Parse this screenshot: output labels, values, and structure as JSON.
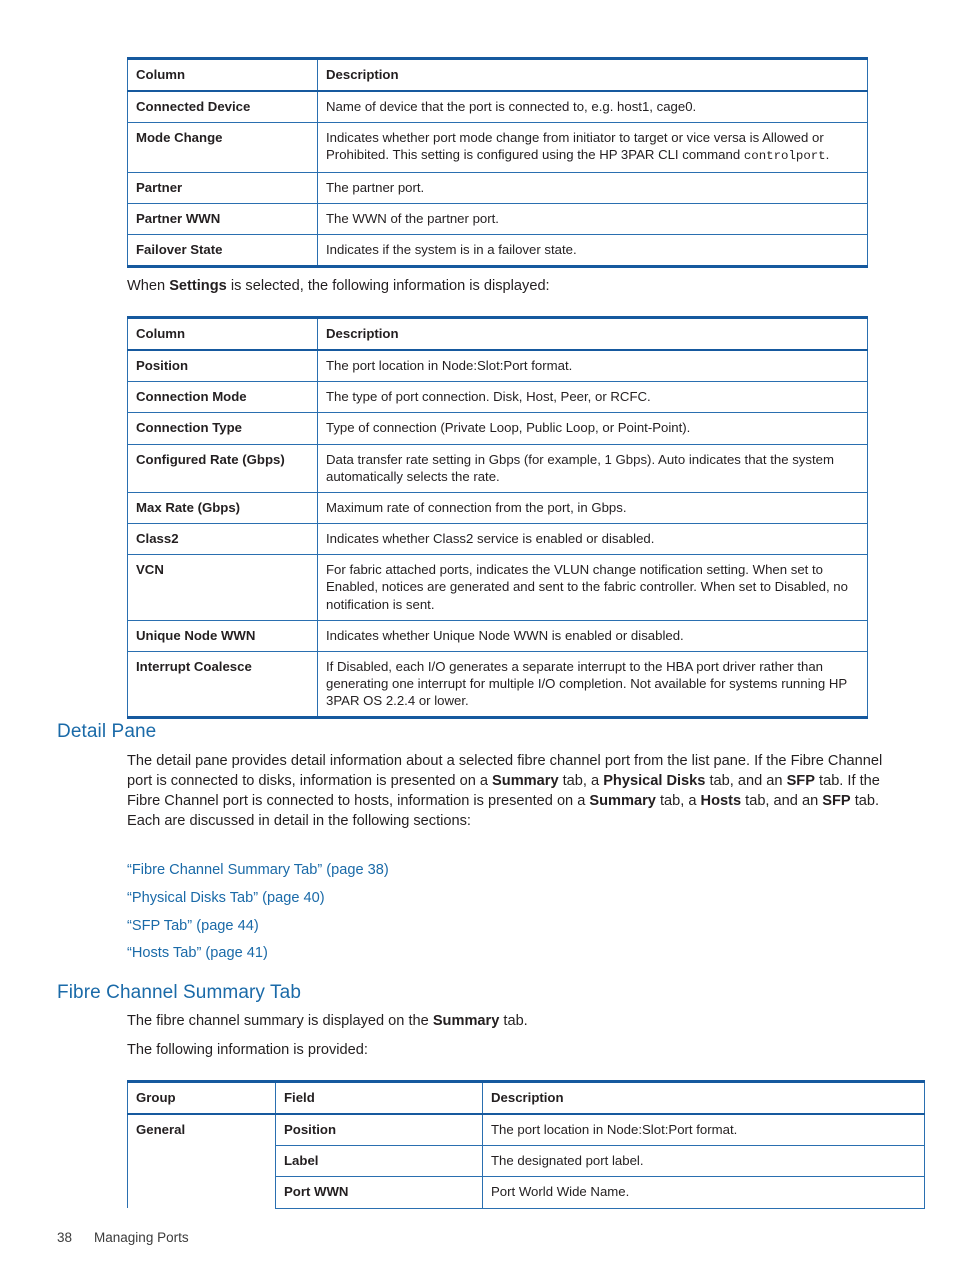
{
  "colors": {
    "heading_blue": "#1a6aa8",
    "table_border_dark": "#16599e",
    "table_border_light": "#2a6fb0",
    "text": "#231f20"
  },
  "table_connected": {
    "headers": [
      "Column",
      "Description"
    ],
    "rows": [
      {
        "column": "Connected Device",
        "description": "Name of device that the port is connected to, e.g. host1, cage0."
      },
      {
        "column": "Mode Change",
        "description_pre": "Indicates whether port mode change from initiator to target or vice versa is Allowed or Prohibited. This setting is configured using the HP 3PAR CLI command ",
        "description_code": "controlport",
        "description_post": "."
      },
      {
        "column": "Partner",
        "description": "The partner port."
      },
      {
        "column": "Partner WWN",
        "description": "The WWN of the partner port."
      },
      {
        "column": "Failover State",
        "description": "Indicates if the system is in a failover state."
      }
    ]
  },
  "intro_settings": {
    "pre": "When ",
    "bold": "Settings",
    "post": " is selected, the following information is displayed:"
  },
  "table_settings": {
    "headers": [
      "Column",
      "Description"
    ],
    "rows": [
      {
        "column": "Position",
        "description": "The port location in Node:Slot:Port format."
      },
      {
        "column": "Connection Mode",
        "description": "The type of port connection. Disk, Host, Peer, or RCFC."
      },
      {
        "column": "Connection Type",
        "description": "Type of connection (Private Loop, Public Loop, or Point-Point)."
      },
      {
        "column": "Configured Rate (Gbps)",
        "description": "Data transfer rate setting in Gbps (for example, 1 Gbps). Auto indicates that the system automatically selects the rate."
      },
      {
        "column": "Max Rate (Gbps)",
        "description": "Maximum rate of connection from the port, in Gbps."
      },
      {
        "column": "Class2",
        "description": "Indicates whether Class2 service is enabled or disabled."
      },
      {
        "column": "VCN",
        "description": "For fabric attached ports, indicates the VLUN change notification setting. When set to Enabled, notices are generated and sent to the fabric controller. When set to Disabled, no notification is sent."
      },
      {
        "column": "Unique Node WWN",
        "description": "Indicates whether Unique Node WWN is enabled or disabled."
      },
      {
        "column": "Interrupt Coalesce",
        "description": "If Disabled, each I/O generates a separate interrupt to the HBA port driver rather than generating one interrupt for multiple I/O completion. Not available for systems running HP 3PAR OS 2.2.4 or lower."
      }
    ]
  },
  "detail_pane": {
    "heading": "Detail Pane",
    "paragraph": {
      "p1": "The detail pane provides detail information about a selected fibre channel port from the list pane. If the Fibre Channel port is connected to disks, information is presented on a ",
      "b1": "Summary",
      "p2": " tab, a ",
      "b2": "Physical Disks",
      "p3": " tab, and an ",
      "b3": "SFP",
      "p4": " tab. If the Fibre Channel port is connected to hosts, information is presented on a ",
      "b4": "Summary",
      "p5": " tab, a ",
      "b5": "Hosts",
      "p6": " tab, and an ",
      "b6": "SFP",
      "p7": " tab. Each are discussed in detail in the following sections:"
    },
    "links": [
      "“Fibre Channel Summary Tab” (page 38)",
      "“Physical Disks Tab” (page 40)",
      "“SFP Tab” (page 44)",
      "“Hosts Tab” (page 41)"
    ]
  },
  "fc_summary": {
    "heading": "Fibre Channel Summary Tab",
    "line1": {
      "pre": "The fibre channel summary is displayed on the ",
      "bold": "Summary",
      "post": " tab."
    },
    "line2": "The following information is provided:"
  },
  "table_summary": {
    "headers": [
      "Group",
      "Field",
      "Description"
    ],
    "rows": [
      {
        "group": "General",
        "field": "Position",
        "description": "The port location in Node:Slot:Port format."
      },
      {
        "group": "",
        "field": "Label",
        "description": "The designated port label."
      },
      {
        "group": "",
        "field": "Port WWN",
        "description": "Port World Wide Name."
      }
    ]
  },
  "footer": {
    "page_number": "38",
    "section": "Managing Ports"
  }
}
